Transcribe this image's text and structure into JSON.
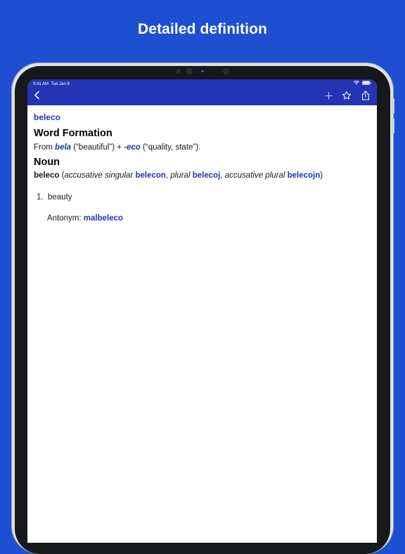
{
  "headline": "Detailed definition",
  "status": {
    "time": "9:41 AM",
    "date": "Tue Jan 9"
  },
  "nav": {
    "back_icon": "chevron-left-icon",
    "add_icon": "plus-icon",
    "favorite_icon": "star-icon",
    "share_icon": "share-icon"
  },
  "entry": {
    "headword": "beleco",
    "word_formation": {
      "title": "Word Formation",
      "from": "From",
      "root": "bela",
      "root_gloss": "(“beautiful”) +",
      "suffix": "-eco",
      "suffix_gloss": "(“quality, state”)."
    },
    "noun": {
      "title": "Noun",
      "lemma": "beleco",
      "open_paren": "(",
      "acc_sg_label": "accusative singular",
      "acc_sg": "belecon",
      "comma1": ",",
      "plural_label": "plural",
      "plural": "belecoj",
      "comma2": ",",
      "acc_pl_label": "accusative plural",
      "acc_pl": "belecojn",
      "close_paren": ")"
    },
    "senses": [
      {
        "number": "1.",
        "gloss": "beauty",
        "antonym_label": "Antonym:",
        "antonym": "malbeleco"
      }
    ]
  },
  "colors": {
    "background": "#1f4fd1",
    "nav": "#2334b4",
    "link": "#2334b4"
  }
}
